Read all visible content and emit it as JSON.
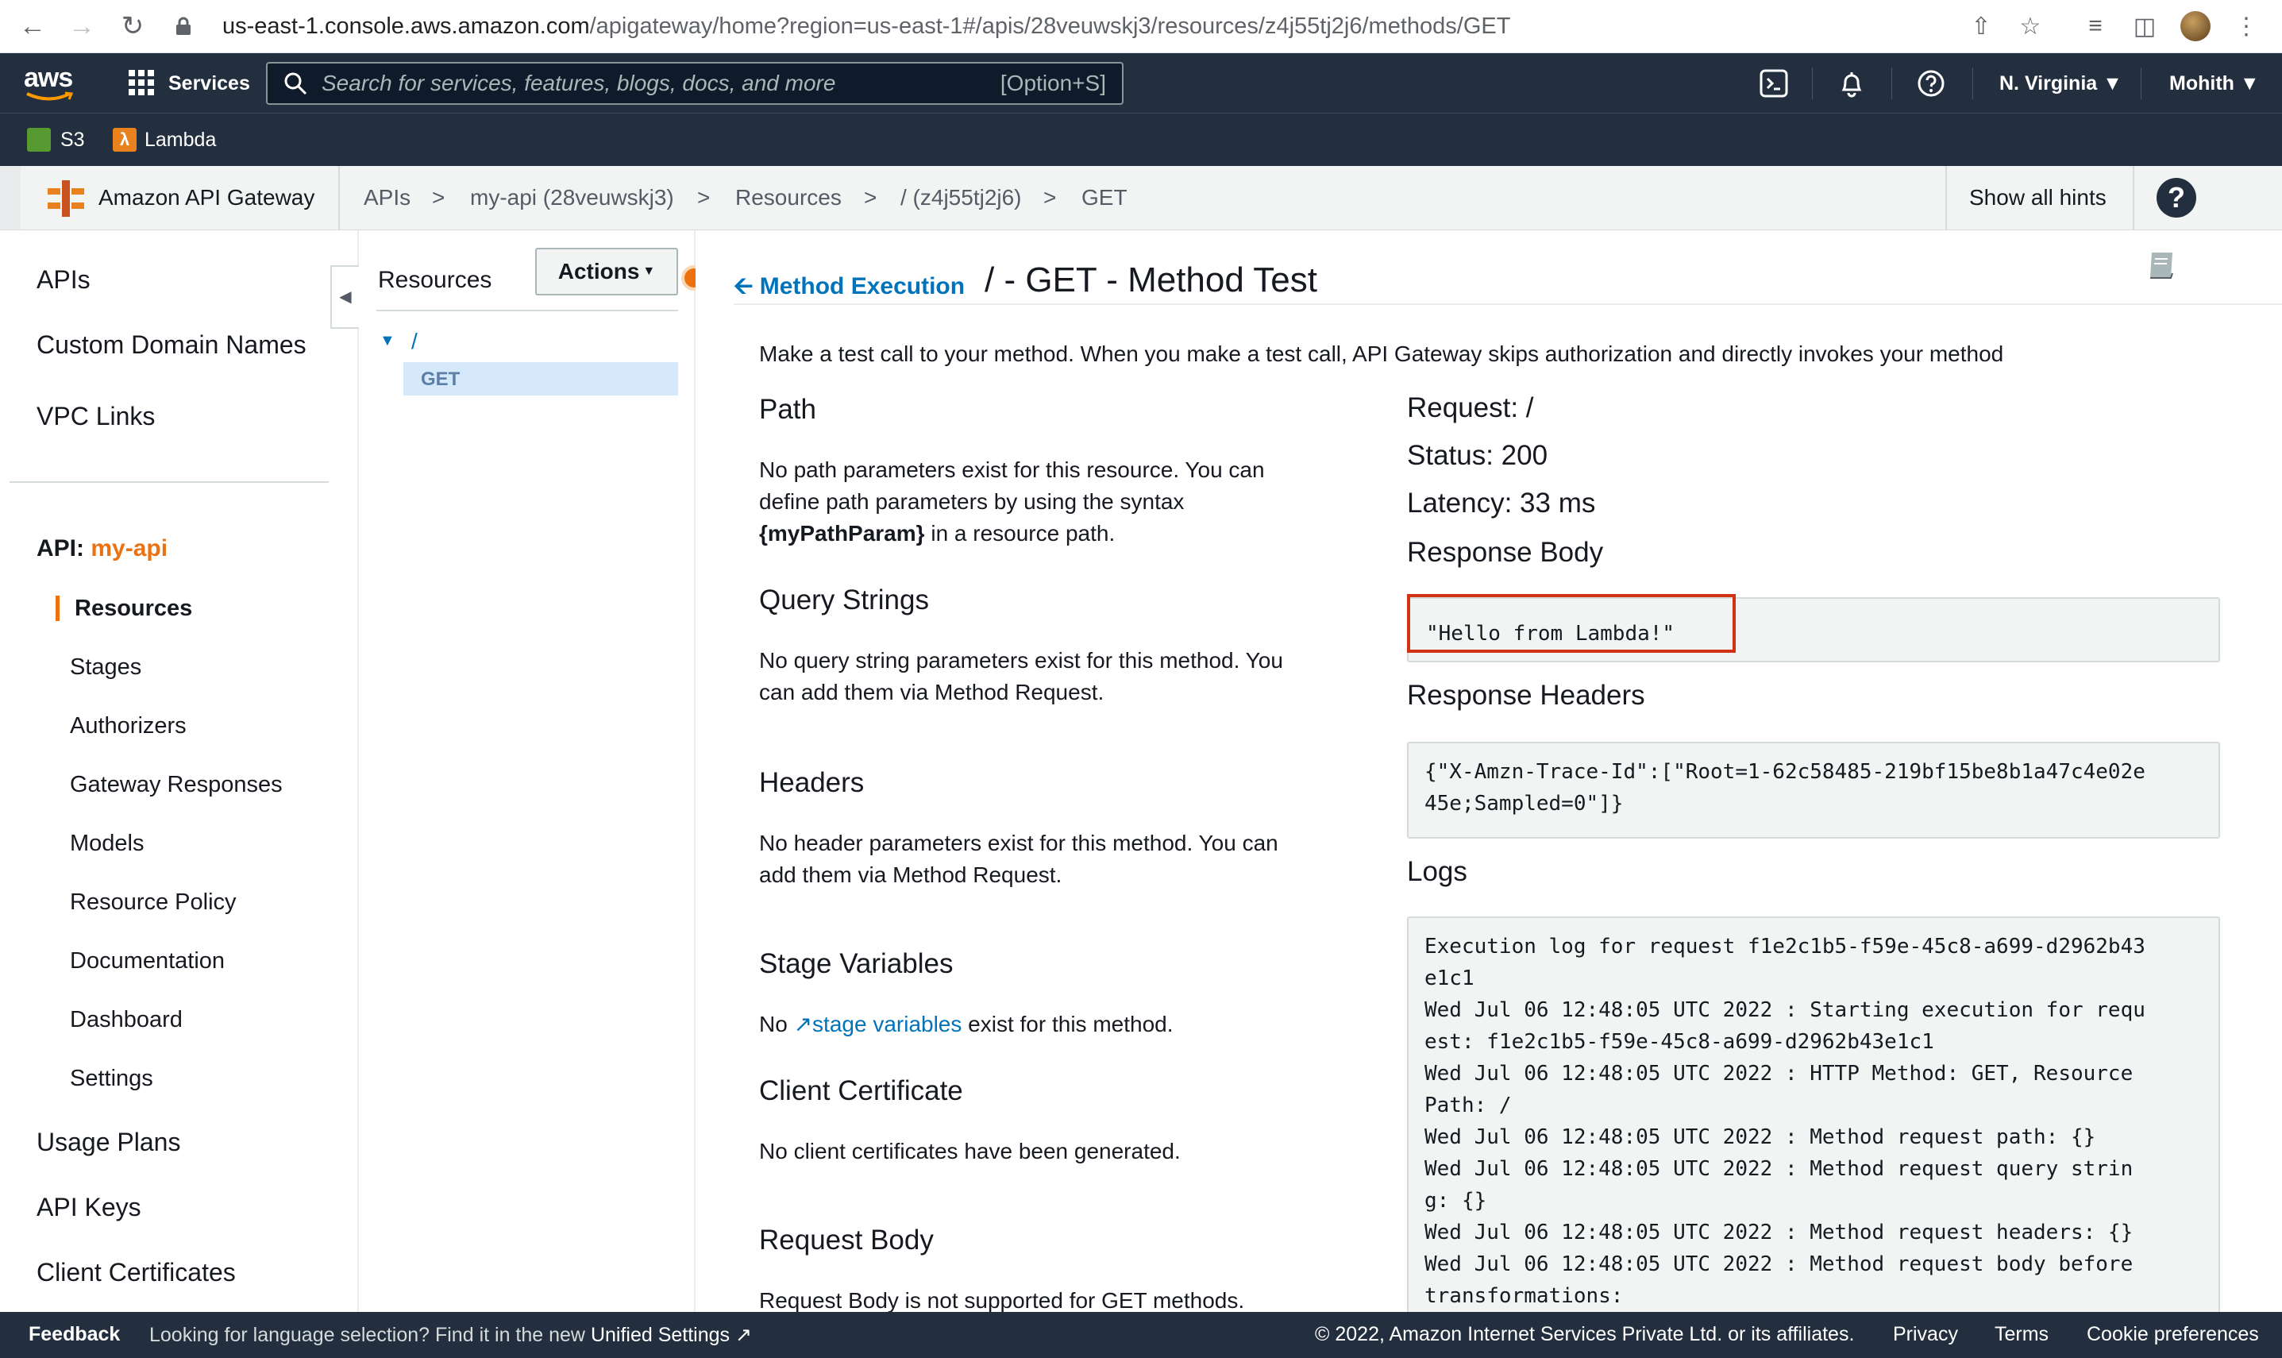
{
  "browser": {
    "url_host": "us-east-1.console.aws.amazon.com",
    "url_path": "/apigateway/home?region=us-east-1#/apis/28veuwskj3/resources/z4j55tj2j6/methods/GET"
  },
  "topnav": {
    "logo": "aws",
    "services_label": "Services",
    "search_placeholder": "Search for services, features, blogs, docs, and more",
    "search_shortcut": "[Option+S]",
    "region": "N. Virginia",
    "user": "Mohith",
    "favorites": [
      {
        "label": "S3",
        "color": "#569a31"
      },
      {
        "label": "Lambda",
        "color": "#e7821f"
      }
    ]
  },
  "servicebar": {
    "service_name": "Amazon API Gateway",
    "breadcrumbs": [
      "APIs",
      "my-api (28veuwskj3)",
      "Resources",
      "/ (z4j55tj2j6)",
      "GET"
    ],
    "separator": ">",
    "show_hints": "Show all hints"
  },
  "leftnav": {
    "top_items": [
      "APIs",
      "Custom Domain Names",
      "VPC Links"
    ],
    "api_prefix": "API:",
    "api_name": "my-api",
    "api_items": [
      "Resources",
      "Stages",
      "Authorizers",
      "Gateway Responses",
      "Models",
      "Resource Policy",
      "Documentation",
      "Dashboard",
      "Settings"
    ],
    "bottom_items": [
      "Usage Plans",
      "API Keys",
      "Client Certificates"
    ]
  },
  "resources": {
    "title": "Resources",
    "actions_label": "Actions",
    "tree_root": "/",
    "tree_method": "GET"
  },
  "main": {
    "back_link": "Method Execution",
    "title": "/ - GET - Method Test",
    "intro": "Make a test call to your method. When you make a test call, API Gateway skips authorization and directly invokes your method",
    "path_heading": "Path",
    "path_text_1": "No path parameters exist for this resource. You can define path parameters by using the syntax",
    "path_syntax": "{myPathParam}",
    "path_text_2": "in a resource path.",
    "query_heading": "Query Strings",
    "query_text": "No query string parameters exist for this method. You can add them via Method Request.",
    "headers_heading": "Headers",
    "headers_text": "No header parameters exist for this method. You can add them via Method Request.",
    "stage_heading": "Stage Variables",
    "stage_text_1": "No",
    "stage_link": "stage variables",
    "stage_text_2": "exist for this method.",
    "cert_heading": "Client Certificate",
    "cert_text": "No client certificates have been generated.",
    "body_heading": "Request Body",
    "body_text": "Request Body is not supported for GET methods."
  },
  "result": {
    "request": "Request: /",
    "status": "Status: 200",
    "latency": "Latency: 33 ms",
    "response_body_heading": "Response Body",
    "response_body": "\"Hello from Lambda!\"",
    "response_headers_heading": "Response Headers",
    "response_headers": "{\"X-Amzn-Trace-Id\":[\"Root=1-62c58485-219bf15be8b1a47c4e02e\n45e;Sampled=0\"]}",
    "logs_heading": "Logs",
    "logs": "Execution log for request f1e2c1b5-f59e-45c8-a699-d2962b43\ne1c1\nWed Jul 06 12:48:05 UTC 2022 : Starting execution for requ\nest: f1e2c1b5-f59e-45c8-a699-d2962b43e1c1\nWed Jul 06 12:48:05 UTC 2022 : HTTP Method: GET, Resource\nPath: /\nWed Jul 06 12:48:05 UTC 2022 : Method request path: {}\nWed Jul 06 12:48:05 UTC 2022 : Method request query strin\ng: {}\nWed Jul 06 12:48:05 UTC 2022 : Method request headers: {}\nWed Jul 06 12:48:05 UTC 2022 : Method request body before\ntransformations:"
  },
  "footer": {
    "feedback": "Feedback",
    "lang_text": "Looking for language selection? Find it in the new",
    "lang_link": "Unified Settings",
    "copyright": "© 2022, Amazon Internet Services Private Ltd. or its affiliates.",
    "privacy": "Privacy",
    "terms": "Terms",
    "cookies": "Cookie preferences"
  },
  "colors": {
    "aws_nav": "#232f3e",
    "link": "#0073bb",
    "orange": "#ec7211",
    "highlight": "#d13212"
  }
}
